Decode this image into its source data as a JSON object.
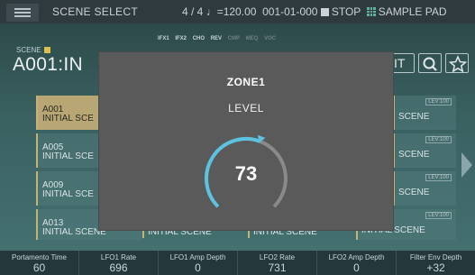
{
  "header": {
    "title": "SCENE SELECT",
    "time_signature": "4 / 4",
    "tempo": "♩=120.00",
    "position": "001-01-000",
    "transport": "STOP",
    "mode": "SAMPLE PAD"
  },
  "fx": [
    "IFX1",
    "IFX2",
    "CHO",
    "REV",
    "CMP",
    "MEQ",
    "VOC"
  ],
  "scene": {
    "label": "SCENE",
    "name": "A001:IN",
    "edit_label": "IT"
  },
  "scene_grid": {
    "left": [
      {
        "num": "A001",
        "name": "INITIAL SCE"
      },
      {
        "num": "A005",
        "name": "INITIAL SCE"
      },
      {
        "num": "A009",
        "name": "INITIAL SCE"
      },
      {
        "num": "A013",
        "name": "INITIAL SCENE"
      }
    ],
    "right": [
      {
        "name": "SCENE",
        "level": "LEV:100"
      },
      {
        "name": "SCENE",
        "level": "LEV:100"
      },
      {
        "name": "SCENE",
        "level": "LEV:100"
      },
      {
        "name": "INITIAL SCENE",
        "level": "LEV:100"
      }
    ],
    "bottom_middle": [
      "INITIAL SCENE",
      "INITIAL SCENE"
    ]
  },
  "dialog": {
    "zone": "ZONE1",
    "parameter": "LEVEL",
    "value": "73",
    "level_value": 73,
    "level_max": 127
  },
  "params": [
    {
      "name": "Portamento Time",
      "value": "60"
    },
    {
      "name": "LFO1 Rate",
      "value": "696"
    },
    {
      "name": "LFO1 Amp Depth",
      "value": "0"
    },
    {
      "name": "LFO2 Rate",
      "value": "731"
    },
    {
      "name": "LFO2 Amp Depth",
      "value": "0"
    },
    {
      "name": "Filter Env Depth",
      "value": "+32"
    }
  ],
  "colors": {
    "accent": "#5cc2e0",
    "selected": "#b8a774"
  }
}
